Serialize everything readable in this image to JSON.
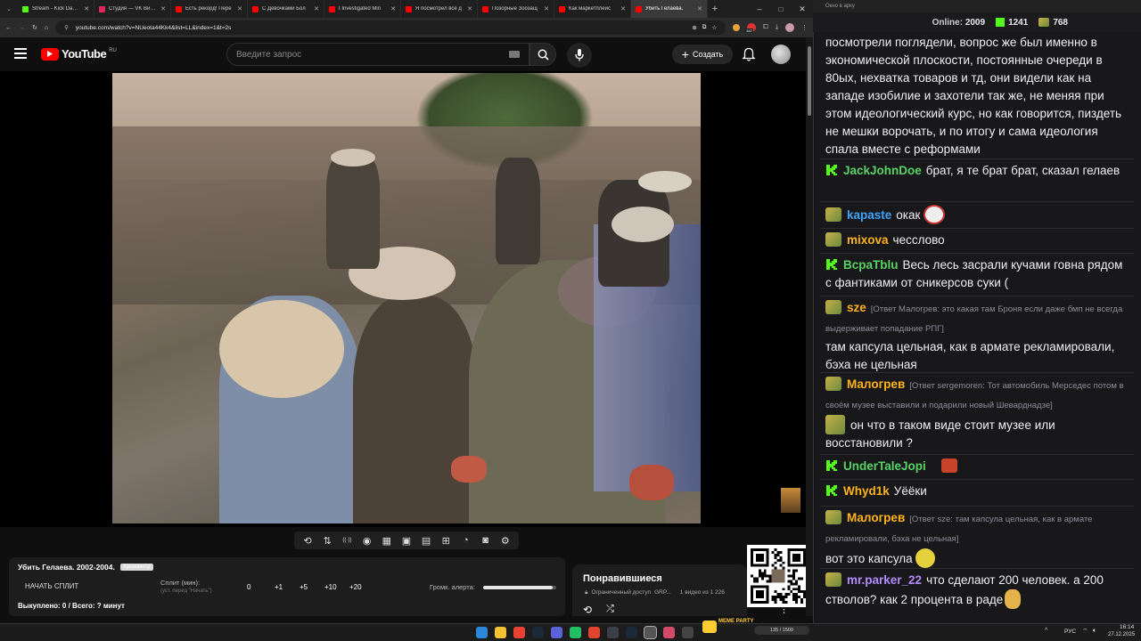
{
  "browser": {
    "tabs": [
      {
        "title": "Stream - Kick Dashb",
        "color": "#53fc18"
      },
      {
        "title": "Студия — VK Видео",
        "color": "#e0245e"
      },
      {
        "title": "Есть рекорд! Пере",
        "color": "#ff0000"
      },
      {
        "title": "С Девочками Бол",
        "color": "#ff0000"
      },
      {
        "title": "I Investigated Min",
        "color": "#ff0000"
      },
      {
        "title": "Я посмотрел все д",
        "color": "#ff0000"
      },
      {
        "title": "Позорные Зоозащ",
        "color": "#ff0000"
      },
      {
        "title": "Как маркетплейс",
        "color": "#ff0000"
      },
      {
        "title": "Убить Гелаева.",
        "color": "#ff0000",
        "active": true
      }
    ],
    "url": "youtube.com/watch?v=NUeota44Kk4&list=LL&index=1&t=2s",
    "extension_badge": "347"
  },
  "youtube": {
    "logo_text": "YouTube",
    "region": "RU",
    "search_placeholder": "Введите запрос",
    "create_label": "Создать"
  },
  "video": {
    "controls": [
      "loop-icon",
      "sort-icon",
      "broadcast-icon",
      "eye-icon",
      "calendar-icon",
      "picture-in-picture-icon",
      "subtitles-icon",
      "add-clip-icon",
      "speed-icon",
      "screenshot-icon",
      "settings-icon"
    ]
  },
  "tracker": {
    "title": "Убить Гелаева. 2002-2004.",
    "title_tag": "Хронометр",
    "start_split_label": "НАЧАТЬ СПЛИТ",
    "split_label": "Сплит (мин):",
    "split_hint": "(уст. перед \"Начать\")",
    "split_value": "0",
    "increments": [
      "+1",
      "+5",
      "+10",
      "+20"
    ],
    "alert_volume_label": "Громк. алерта:",
    "alert_volume": 0.95,
    "progress_text": "Выкуплено: 0 / Всего: ? минут"
  },
  "playlist": {
    "title": "Понравившиеся",
    "access": "Ограниченный доступ",
    "owner": "GRP...",
    "count": "1 видео из 1 226"
  },
  "chat": {
    "window_title": "Окно в арку",
    "online_label": "Online:",
    "online_count": "2009",
    "kick_count": "1241",
    "other_count": "768",
    "messages": [
      {
        "nick": "",
        "text": "посмотрели поглядели, вопрос же был именно в экономической плоскости, постоянные очереди в 80ых, нехватка товаров и тд, они видели как на западе изобилие и захотели так же, не меняя при этом идеологический курс, но как говорится, пиздеть не мешки ворочать, и по итогу и сама идеология спала вместе с реформами"
      },
      {
        "nick": "JackJohnDoe",
        "color": "#56d364",
        "badge": "kick",
        "text": "брат, я те брат брат, сказал гелаев"
      },
      {
        "nick": "kapaste",
        "color": "#3ea6ff",
        "badge": "avatar",
        "text": "окак"
      },
      {
        "nick": "mixova",
        "color": "#ffb31a",
        "badge": "avatar",
        "text": "чесслово"
      },
      {
        "nick": "BcpaTblu",
        "color": "#56d364",
        "badge": "kick",
        "text": "Весь лесь засрали кучами говна рядом с фантиками от сникерсов суки ("
      },
      {
        "nick": "sze",
        "color": "#ffb31a",
        "badge": "avatar",
        "reply": "[Ответ Малогрев: это какая там Броня если даже бмп не всегда выдерживает попадание РПГ]",
        "text": "там капсула цельная, как в армате рекламировали, бэха не цельная"
      },
      {
        "nick": "Малогрев",
        "color": "#ffb31a",
        "badge": "avatar",
        "reply": "[Ответ sergemoren: Тот автомобиль Мерседес потом в своём музее выставили и подарили новый Шеварднадзе]",
        "text": "он что в таком виде стоит музее или восстановили ?"
      },
      {
        "nick": "UnderTaleJopi",
        "color": "#56d364",
        "badge": "kick",
        "text": ""
      },
      {
        "nick": "Whyd1k",
        "color": "#ffb31a",
        "badge": "kick",
        "text": "Уёёки"
      },
      {
        "nick": "Малогрев",
        "color": "#ffb31a",
        "badge": "avatar",
        "reply": "[Ответ sze: там капсула цельная, как в армате рекламировали, бэха не цельная]",
        "text": "вот это капсула"
      },
      {
        "nick": "mr.parker_22",
        "color": "#b38bff",
        "badge": "avatar",
        "text": "что сделают 200 человек. а 200 стволов? как 2 процента в раде"
      }
    ]
  },
  "taskbar": {
    "lang": "РУС",
    "time": "16:14",
    "date": "27.12.2025",
    "meme_label": "MEME PARTY",
    "meme_progress": "135 / 1500"
  }
}
